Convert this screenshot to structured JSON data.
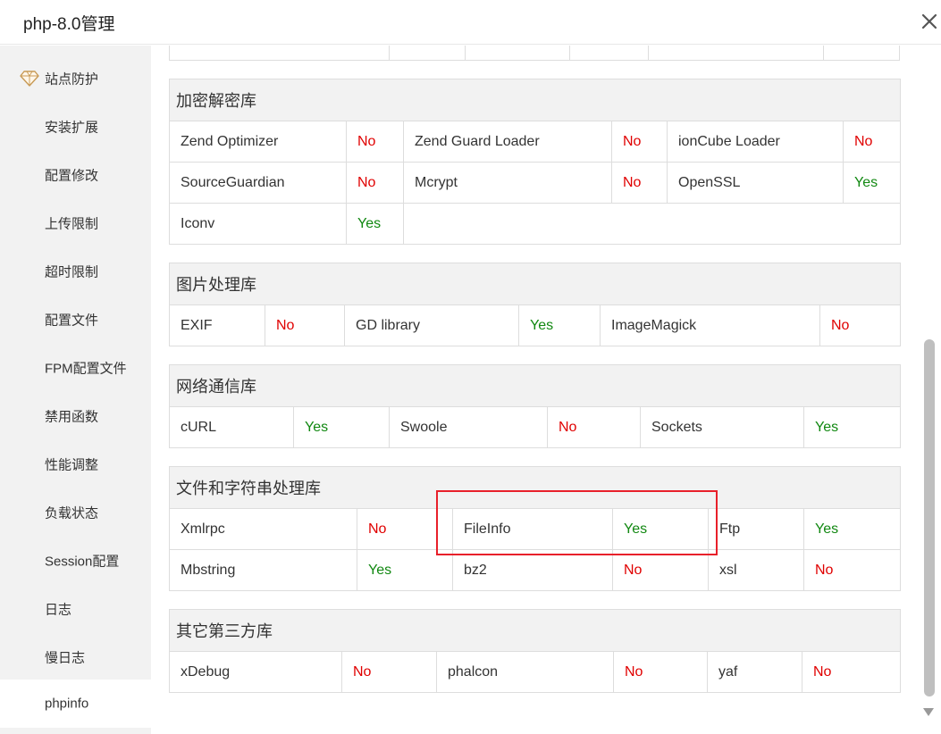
{
  "window": {
    "title": "php-8.0管理"
  },
  "sidebar": {
    "items": [
      {
        "label": "站点防护",
        "icon": "gem-icon"
      },
      {
        "label": "安装扩展"
      },
      {
        "label": "配置修改"
      },
      {
        "label": "上传限制"
      },
      {
        "label": "超时限制"
      },
      {
        "label": "配置文件"
      },
      {
        "label": "FPM配置文件"
      },
      {
        "label": "禁用函数"
      },
      {
        "label": "性能调整"
      },
      {
        "label": "负载状态"
      },
      {
        "label": "Session配置"
      },
      {
        "label": "日志"
      },
      {
        "label": "慢日志"
      },
      {
        "label": "phpinfo"
      }
    ],
    "active": "phpinfo"
  },
  "sections": {
    "crypto": {
      "title": "加密解密库",
      "rows": [
        [
          {
            "name": "Zend Optimizer",
            "status": "No"
          },
          {
            "name": "Zend Guard Loader",
            "status": "No"
          },
          {
            "name": "ionCube Loader",
            "status": "No"
          }
        ],
        [
          {
            "name": "SourceGuardian",
            "status": "No"
          },
          {
            "name": "Mcrypt",
            "status": "No"
          },
          {
            "name": "OpenSSL",
            "status": "Yes"
          }
        ],
        [
          {
            "name": "Iconv",
            "status": "Yes"
          }
        ]
      ]
    },
    "image": {
      "title": "图片处理库",
      "rows": [
        [
          {
            "name": "EXIF",
            "status": "No"
          },
          {
            "name": "GD library",
            "status": "Yes"
          },
          {
            "name": "ImageMagick",
            "status": "No"
          }
        ]
      ]
    },
    "network": {
      "title": "网络通信库",
      "rows": [
        [
          {
            "name": "cURL",
            "status": "Yes"
          },
          {
            "name": "Swoole",
            "status": "No"
          },
          {
            "name": "Sockets",
            "status": "Yes"
          }
        ]
      ]
    },
    "file_string": {
      "title": "文件和字符串处理库",
      "rows": [
        [
          {
            "name": "Xmlrpc",
            "status": "No"
          },
          {
            "name": "FileInfo",
            "status": "Yes"
          },
          {
            "name": "Ftp",
            "status": "Yes"
          }
        ],
        [
          {
            "name": "Mbstring",
            "status": "Yes"
          },
          {
            "name": "bz2",
            "status": "No"
          },
          {
            "name": "xsl",
            "status": "No"
          }
        ]
      ]
    },
    "third_party": {
      "title": "其它第三方库",
      "rows": [
        [
          {
            "name": "xDebug",
            "status": "No"
          },
          {
            "name": "phalcon",
            "status": "No"
          },
          {
            "name": "yaf",
            "status": "No"
          }
        ]
      ]
    }
  },
  "colors": {
    "no": "#e00000",
    "yes": "#118811",
    "highlight": "#e8202a"
  }
}
